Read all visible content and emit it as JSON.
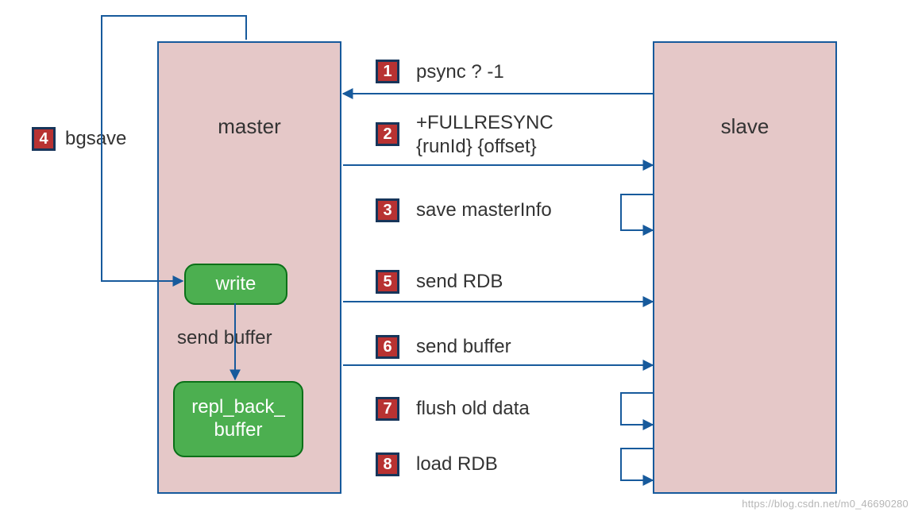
{
  "nodes": {
    "master": "master",
    "slave": "slave",
    "write": "write",
    "buffer": "repl_back_\nbuffer"
  },
  "internal": {
    "send_buffer": "send buffer"
  },
  "steps": {
    "s1": {
      "num": "1",
      "label": "psync ? -1"
    },
    "s2": {
      "num": "2",
      "label": "+FULLRESYNC\n{runId} {offset}"
    },
    "s3": {
      "num": "3",
      "label": "save masterInfo"
    },
    "s4": {
      "num": "4",
      "label": "bgsave"
    },
    "s5": {
      "num": "5",
      "label": "send RDB"
    },
    "s6": {
      "num": "6",
      "label": "send buffer"
    },
    "s7": {
      "num": "7",
      "label": "flush old data"
    },
    "s8": {
      "num": "8",
      "label": "load RDB"
    }
  },
  "watermark": "https://blog.csdn.net/m0_46690280"
}
